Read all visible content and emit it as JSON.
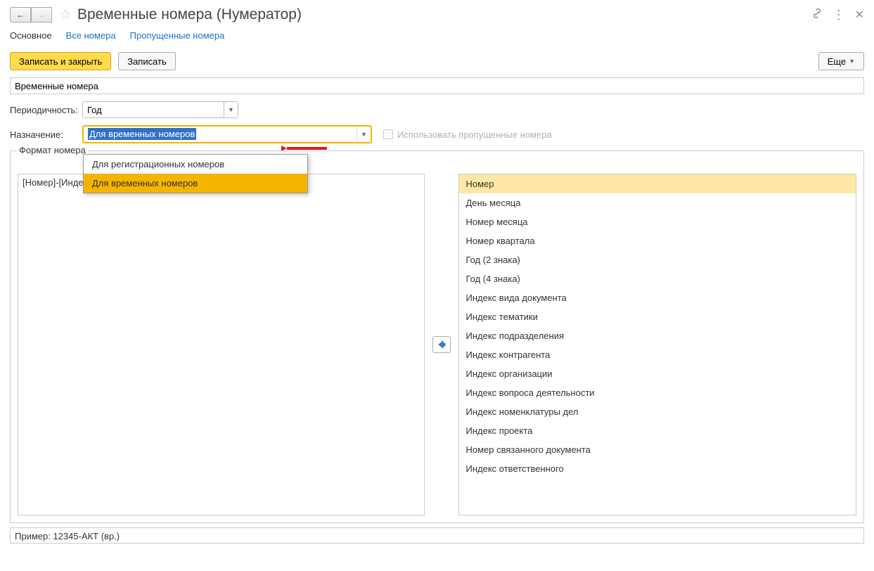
{
  "header": {
    "title": "Временные номера (Нумератор)"
  },
  "tabs": [
    {
      "label": "Основное",
      "active": true
    },
    {
      "label": "Все номера",
      "active": false
    },
    {
      "label": "Пропущенные номера",
      "active": false
    }
  ],
  "toolbar": {
    "save_close": "Записать и закрыть",
    "save": "Записать",
    "more": "Еще"
  },
  "name_field": {
    "value": "Временные номера"
  },
  "periodicity": {
    "label": "Периодичность:",
    "value": "Год"
  },
  "purpose": {
    "label": "Назначение:",
    "value": "Для временных номеров",
    "options": [
      "Для регистрационных номеров",
      "Для временных номеров"
    ],
    "selected_index": 1
  },
  "checkbox_use_skipped": {
    "label": "Использовать пропущенные номера",
    "checked": false
  },
  "format_group": {
    "legend": "Формат номера",
    "left_value": "[Номер]-[Индек",
    "right_items": [
      "Номер",
      "День месяца",
      "Номер месяца",
      "Номер квартала",
      "Год (2 знака)",
      "Год (4 знака)",
      "Индекс вида документа",
      "Индекс тематики",
      "Индекс подразделения",
      "Индекс контрагента",
      "Индекс организации",
      "Индекс вопроса деятельности",
      "Индекс номенклатуры дел",
      "Индекс проекта",
      "Номер связанного документа",
      "Индекс ответственного"
    ],
    "selected_right_index": 0
  },
  "example": {
    "text": "Пример: 12345-АКТ (вр.)"
  }
}
